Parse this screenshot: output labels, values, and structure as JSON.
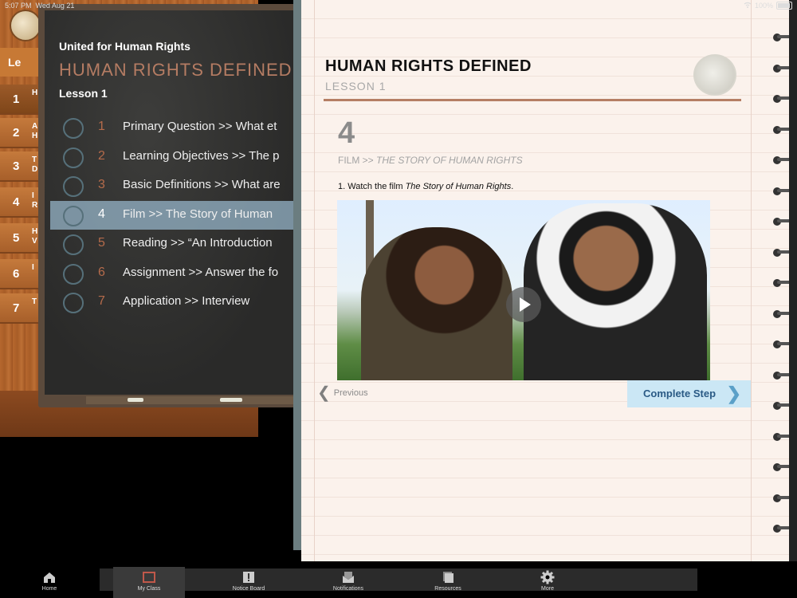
{
  "status_bar": {
    "time": "5:07 PM",
    "date": "Wed Aug 21",
    "battery": "100%"
  },
  "shelf": {
    "header": "Le",
    "items": [
      {
        "num": "1",
        "abbr": "H"
      },
      {
        "num": "2",
        "abbr": "A\nH"
      },
      {
        "num": "3",
        "abbr": "T\nD"
      },
      {
        "num": "4",
        "abbr": "I\nR"
      },
      {
        "num": "5",
        "abbr": "H\nV"
      },
      {
        "num": "6",
        "abbr": "I"
      },
      {
        "num": "7",
        "abbr": "T"
      }
    ]
  },
  "chalkboard": {
    "org": "United for Human Rights",
    "title": "HUMAN RIGHTS DEFINED",
    "lesson": "Lesson 1",
    "steps": [
      {
        "num": "1",
        "label": "Primary Question >> What et"
      },
      {
        "num": "2",
        "label": "Learning Objectives >> The p"
      },
      {
        "num": "3",
        "label": "Basic Definitions >> What are"
      },
      {
        "num": "4",
        "label": "Film >> The Story of Human"
      },
      {
        "num": "5",
        "label": "Reading >> “An Introduction"
      },
      {
        "num": "6",
        "label": "Assignment >> Answer the fo"
      },
      {
        "num": "7",
        "label": "Application >> Interview"
      }
    ]
  },
  "notebook": {
    "title": "HUMAN RIGHTS DEFINED",
    "lesson": "LESSON 1",
    "step_number": "4",
    "film_prefix": "FILM >> ",
    "film_title": "THE STORY OF HUMAN RIGHTS",
    "instruction_prefix": "1. Watch the film ",
    "instruction_film": "The Story of Human Rights",
    "instruction_suffix": ".",
    "previous_label": "Previous",
    "complete_label": "Complete Step"
  },
  "tabs": [
    {
      "label": "Home",
      "icon": "home-icon"
    },
    {
      "label": "My Class",
      "icon": "class-icon"
    },
    {
      "label": "Notice Board",
      "icon": "notice-icon"
    },
    {
      "label": "Notifications",
      "icon": "notifications-icon"
    },
    {
      "label": "Resources",
      "icon": "resources-icon"
    },
    {
      "label": "More",
      "icon": "gear-icon"
    }
  ]
}
